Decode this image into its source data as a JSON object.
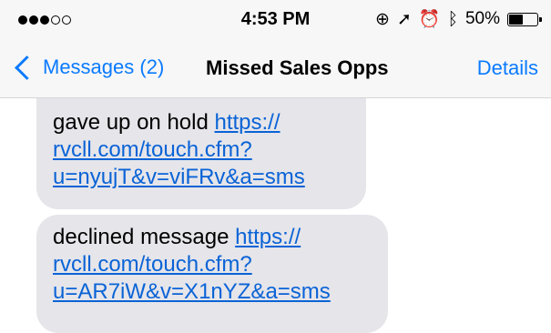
{
  "status_bar": {
    "time": "4:53 PM",
    "battery_text": "50%",
    "battery_level": 0.5,
    "signal_bars_filled": 3,
    "signal_bars_total": 5
  },
  "nav": {
    "back_label": "Messages (2)",
    "title": "Missed Sales Opps",
    "details_label": "Details"
  },
  "messages": [
    {
      "text": "gave up on hold ",
      "link_line1": "https://",
      "link_line2": "rvcll.com/touch.cfm?",
      "link_line3": "u=nyujT&v=viFRv&a=sms"
    },
    {
      "text": "declined message ",
      "link_line1": "https://",
      "link_line2": "rvcll.com/touch.cfm?",
      "link_line3": "u=AR7iW&v=X1nYZ&a=sms"
    }
  ],
  "colors": {
    "accent": "#0a7aff",
    "bubble_bg": "#e5e5ea",
    "link": "#0a63d6"
  }
}
